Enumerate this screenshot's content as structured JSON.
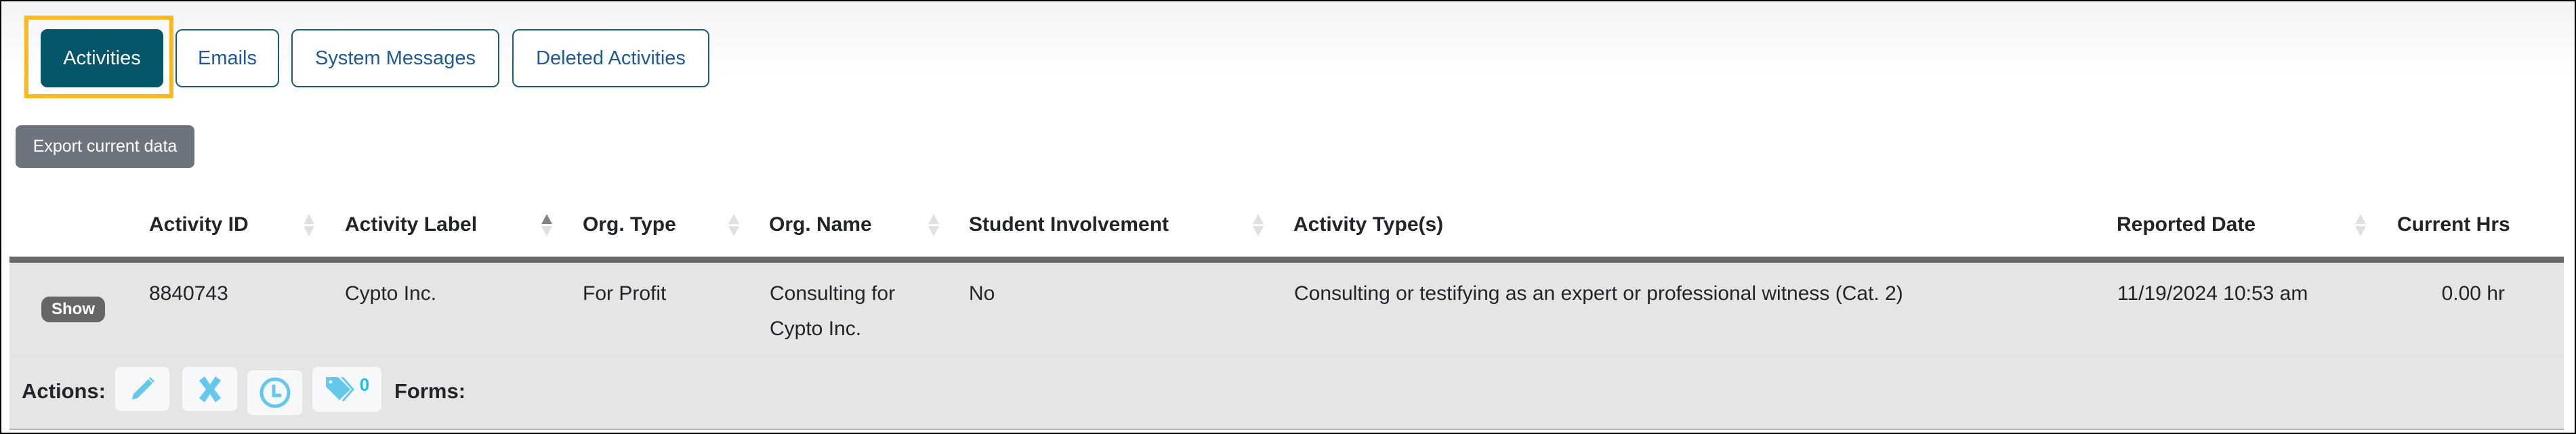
{
  "tabs": [
    {
      "label": "Activities",
      "active": true
    },
    {
      "label": "Emails",
      "active": false
    },
    {
      "label": "System Messages",
      "active": false
    },
    {
      "label": "Deleted Activities",
      "active": false
    }
  ],
  "toolbar": {
    "export_label": "Export current data"
  },
  "table": {
    "columns": [
      {
        "label": "Activity ID",
        "sort": "none"
      },
      {
        "label": "Activity Label",
        "sort": "asc"
      },
      {
        "label": "Org. Type",
        "sort": "none"
      },
      {
        "label": "Org. Name",
        "sort": "none"
      },
      {
        "label": "Student Involvement",
        "sort": "none"
      },
      {
        "label": "Activity Type(s)",
        "sort": null
      },
      {
        "label": "Reported Date",
        "sort": "none"
      },
      {
        "label": "Current Hrs",
        "sort": null
      }
    ],
    "rows": [
      {
        "show_label": "Show",
        "activity_id": "8840743",
        "activity_label": "Cypto Inc.",
        "org_type": "For Profit",
        "org_name_line1": "Consulting for",
        "org_name_line2": "Cypto Inc.",
        "student_involvement": "No",
        "activity_types": "Consulting or testifying as an expert or professional witness (Cat. 2)",
        "reported_date": "11/19/2024 10:53 am",
        "current_hrs": "0.00 hr",
        "actions_label": "Actions:",
        "actions": [
          {
            "name": "edit",
            "icon": "pencil-icon"
          },
          {
            "name": "delete",
            "icon": "x-icon"
          },
          {
            "name": "history",
            "icon": "clock-icon"
          },
          {
            "name": "tags",
            "icon": "tags-icon",
            "count": "0"
          }
        ],
        "forms_label": "Forms:"
      }
    ]
  },
  "colors": {
    "active_tab": "#05566b",
    "highlight": "#fbb81f",
    "icon": "#63c8ec",
    "tag_count": "#14c0e8"
  }
}
